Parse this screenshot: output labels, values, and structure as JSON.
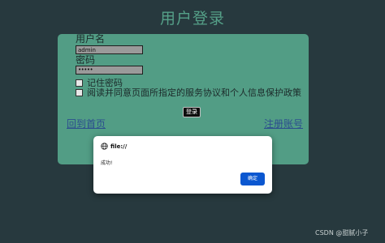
{
  "page": {
    "title": "用户登录"
  },
  "form": {
    "username_label": "用户名",
    "username_value": "admin",
    "password_label": "密码",
    "password_value": "•••••",
    "remember_label": "记住密码",
    "agreement_label": "阅读并同意页面所指定的服务协议和个人信息保护政策",
    "login_button": "登录",
    "home_link": "回到首页",
    "register_link": "注册账号"
  },
  "dialog": {
    "origin": "file://",
    "message": "成功!",
    "ok_button": "确定"
  },
  "watermark": {
    "text": "CSDN @甜腻小子"
  },
  "colors": {
    "background": "#27393e",
    "panel": "#529d85",
    "title": "#55a088",
    "link": "#2c4e8e",
    "dialog_button": "#0b57d0"
  },
  "icons": {
    "dialog_origin_icon": "globe-icon"
  }
}
